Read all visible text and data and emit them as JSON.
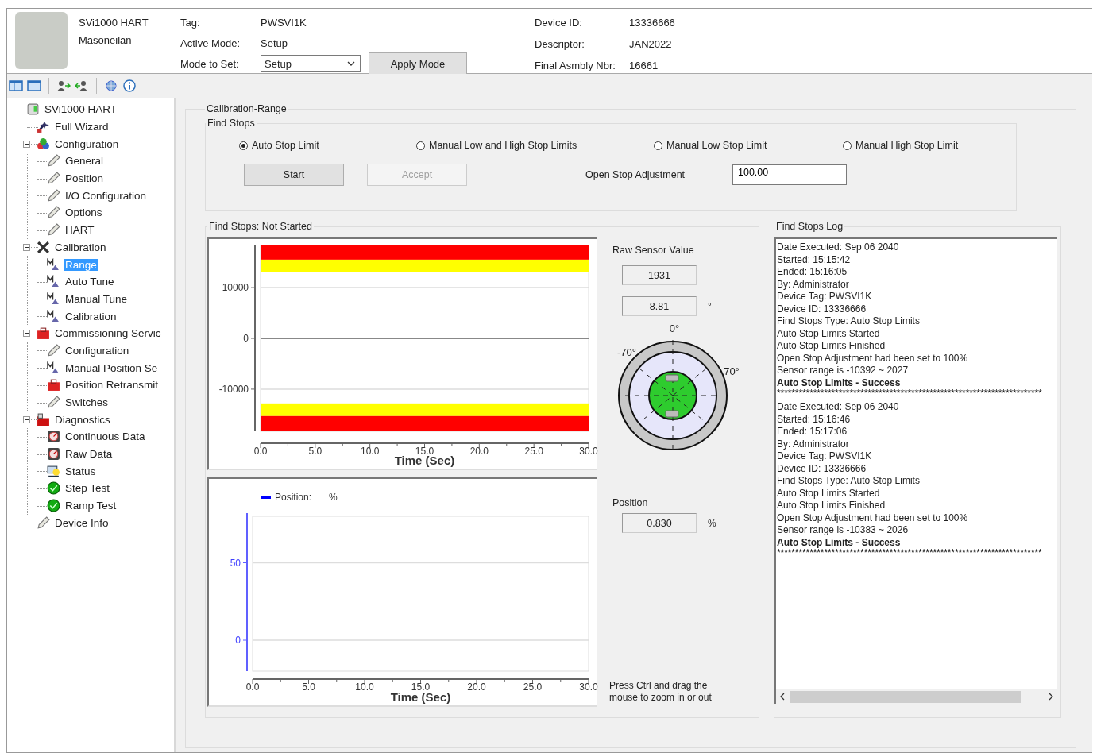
{
  "header": {
    "device_name": "SVi1000 HART",
    "manufacturer": "Masoneilan",
    "fields": [
      {
        "label": "Tag:",
        "value": "PWSVI1K"
      },
      {
        "label": "Active Mode:",
        "value": "Setup"
      }
    ],
    "mode_to_set": {
      "label": "Mode to Set:",
      "value": "Setup"
    },
    "apply_button": "Apply Mode",
    "info": [
      {
        "label": "Device ID:",
        "value": "13336666"
      },
      {
        "label": "Descriptor:",
        "value": "JAN2022"
      },
      {
        "label": "Final Asmbly Nbr:",
        "value": "16661"
      }
    ]
  },
  "tree": {
    "label": "SVi1000 HART",
    "kind": "device",
    "selected": false,
    "children": [
      {
        "label": "Full Wizard",
        "kind": "wizard",
        "selected": false
      },
      {
        "label": "Configuration",
        "kind": "shapes",
        "selected": false,
        "expanded": true,
        "children": [
          {
            "label": "General",
            "kind": "pencil",
            "selected": false
          },
          {
            "label": "Position",
            "kind": "pencil",
            "selected": false
          },
          {
            "label": "I/O Configuration",
            "kind": "pencil",
            "selected": false
          },
          {
            "label": "Options",
            "kind": "pencil",
            "selected": false
          },
          {
            "label": "HART",
            "kind": "pencil",
            "selected": false
          }
        ]
      },
      {
        "label": "Calibration",
        "kind": "tools",
        "selected": false,
        "expanded": true,
        "children": [
          {
            "label": "Range",
            "kind": "tune",
            "selected": true
          },
          {
            "label": "Auto Tune",
            "kind": "tune",
            "selected": false
          },
          {
            "label": "Manual Tune",
            "kind": "tune",
            "selected": false
          },
          {
            "label": "Calibration",
            "kind": "tune",
            "selected": false
          }
        ]
      },
      {
        "label": "Commissioning Servic",
        "kind": "toolbox",
        "selected": false,
        "expanded": true,
        "children": [
          {
            "label": "Configuration",
            "kind": "pencil",
            "selected": false
          },
          {
            "label": "Manual Position Se",
            "kind": "tune",
            "selected": false
          },
          {
            "label": "Position Retransmit",
            "kind": "toolbox",
            "selected": false
          },
          {
            "label": "Switches",
            "kind": "pencil",
            "selected": false
          }
        ]
      },
      {
        "label": "Diagnostics",
        "kind": "folder",
        "selected": false,
        "expanded": true,
        "children": [
          {
            "label": "Continuous Data",
            "kind": "gauge",
            "selected": false
          },
          {
            "label": "Raw Data",
            "kind": "gauge",
            "selected": false
          },
          {
            "label": "Status",
            "kind": "monitor",
            "selected": false
          },
          {
            "label": "Step Test",
            "kind": "test",
            "selected": false
          },
          {
            "label": "Ramp Test",
            "kind": "test",
            "selected": false
          }
        ]
      },
      {
        "label": "Device Info",
        "kind": "pencil",
        "selected": false
      }
    ]
  },
  "panel": {
    "title": "Calibration-Range",
    "find_stops": {
      "title": "Find Stops",
      "options": [
        {
          "label": "Auto Stop Limit",
          "selected": true
        },
        {
          "label": "Manual Low and High Stop Limits",
          "selected": false
        },
        {
          "label": "Manual Low Stop Limit",
          "selected": false
        },
        {
          "label": "Manual High Stop Limit",
          "selected": false
        }
      ],
      "start_button": {
        "label": "Start",
        "disabled": false
      },
      "accept_button": {
        "label": "Accept",
        "disabled": true
      },
      "open_stop_adjustment": {
        "label": "Open Stop Adjustment",
        "value": "100.00"
      }
    },
    "status_group": {
      "title": "Find Stops: Not Started",
      "sensor_chart": {
        "chart_data": {
          "type": "line",
          "xlabel": "Time (Sec)",
          "xlim": [
            0,
            30
          ],
          "ylim": [
            -18300,
            18300
          ],
          "xticks": [
            {
              "value": 0,
              "label": "0.0"
            },
            {
              "value": 5,
              "label": "5.0"
            },
            {
              "value": 10,
              "label": "10.0"
            },
            {
              "value": 15,
              "label": "15.0"
            },
            {
              "value": 20,
              "label": "20.0"
            },
            {
              "value": 25,
              "label": "25.0"
            },
            {
              "value": 30,
              "label": "30.0"
            }
          ],
          "yticks": [
            -10000,
            0,
            10000
          ],
          "bands": [
            {
              "axis": "y",
              "from": 15500,
              "to": 18300,
              "color": "#ff0000"
            },
            {
              "axis": "y",
              "from": 13100,
              "to": 15500,
              "color": "#ffff00"
            },
            {
              "axis": "y",
              "from": -15300,
              "to": -12800,
              "color": "#ffff00"
            },
            {
              "axis": "y",
              "from": -18300,
              "to": -15300,
              "color": "#ff0000"
            }
          ]
        }
      },
      "raw_sensor": {
        "label": "Raw Sensor Value",
        "counts": "1931",
        "angle": "8.81",
        "angle_unit": "°"
      },
      "dial": {
        "top_label": "0°",
        "left_label": "-70°",
        "right_label": "70°"
      },
      "position_chart": {
        "chart_data": {
          "type": "line",
          "xlabel": "Time (Sec)",
          "xlim": [
            0,
            30
          ],
          "ylim": [
            -20,
            80
          ],
          "xticks": [
            {
              "value": 0,
              "label": "0.0"
            },
            {
              "value": 5,
              "label": "5.0"
            },
            {
              "value": 10,
              "label": "10.0"
            },
            {
              "value": 15,
              "label": "15.0"
            },
            {
              "value": 20,
              "label": "20.0"
            },
            {
              "value": 25,
              "label": "25.0"
            },
            {
              "value": 30,
              "label": "30.0"
            }
          ],
          "yticks": [
            0,
            50
          ],
          "ylabel": "%"
        },
        "legend": {
          "name": "Position:",
          "color": "#0000ff"
        }
      },
      "position": {
        "label": "Position",
        "value": "0.830",
        "unit": "%"
      },
      "hint": "Press Ctrl and drag the mouse to zoom in or out"
    },
    "log": {
      "title": "Find Stops Log",
      "entries": [
        {
          "lines": [
            "Date Executed: Sep 06 2040",
            "Started: 15:15:42",
            "Ended: 15:16:05",
            "By: Administrator",
            "Device Tag: PWSVI1K",
            "Device ID: 13336666",
            "Find Stops Type: Auto Stop Limits",
            "Auto Stop Limits Started",
            "Auto Stop Limits Finished",
            "Open Stop Adjustment had been set to 100%",
            "Sensor range is -10392 ~ 2027"
          ],
          "result": "Auto Stop Limits - Success",
          "separator": "*************************************************************************"
        },
        {
          "lines": [
            "Date Executed: Sep 06 2040",
            "Started: 15:16:46",
            "Ended: 15:17:06",
            "By: Administrator",
            "Device Tag: PWSVI1K",
            "Device ID: 13336666",
            "Find Stops Type: Auto Stop Limits",
            "Auto Stop Limits Started",
            "Auto Stop Limits Finished",
            "Open Stop Adjustment had been set to 100%",
            "Sensor range is -10383 ~ 2026"
          ],
          "result": "Auto Stop Limits - Success",
          "separator": "*************************************************************************"
        }
      ]
    }
  }
}
